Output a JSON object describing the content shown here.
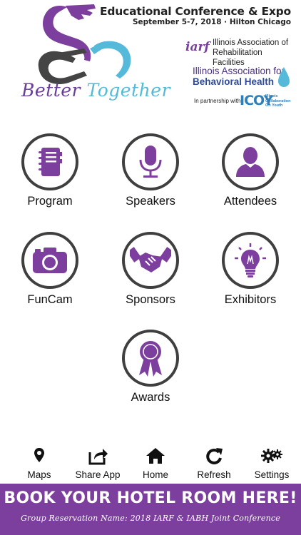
{
  "header": {
    "tagline_word1": "Better",
    "tagline_word2": "Together",
    "conference_title": "Educational Conference & Expo",
    "conference_date": "September 5-7, 2018 · Hilton Chicago",
    "iarf": {
      "mark": "iarf",
      "line1": "Illinois Association of",
      "line2": "Rehabilitation Facilities"
    },
    "iabh": {
      "line1": "Illinois Association for",
      "line2": "Behavioral Health"
    },
    "partner": {
      "prefix": "In partnership with",
      "mark": "ICOY",
      "line1": "Illinois",
      "line2": "Collaboration",
      "line3": "On Youth"
    },
    "colors": {
      "purple": "#7d3f9e",
      "blue": "#55b9d9",
      "dark": "#3f3f3f"
    }
  },
  "tiles": [
    {
      "label": "Program",
      "icon": "notebook-icon"
    },
    {
      "label": "Speakers",
      "icon": "microphone-icon"
    },
    {
      "label": "Attendees",
      "icon": "person-icon"
    },
    {
      "label": "FunCam",
      "icon": "camera-icon"
    },
    {
      "label": "Sponsors",
      "icon": "handshake-icon"
    },
    {
      "label": "Exhibitors",
      "icon": "lightbulb-icon"
    },
    {
      "label": "Awards",
      "icon": "award-ribbon-icon"
    }
  ],
  "toolbar": [
    {
      "label": "Maps",
      "icon": "map-pin-icon"
    },
    {
      "label": "Share App",
      "icon": "share-icon"
    },
    {
      "label": "Home",
      "icon": "home-icon"
    },
    {
      "label": "Refresh",
      "icon": "refresh-icon"
    },
    {
      "label": "Settings",
      "icon": "gear-icon"
    }
  ],
  "hotel_banner": {
    "headline": "BOOK YOUR HOTEL ROOM HERE!",
    "subline": "Group Reservation Name: 2018 IARF & IABH Joint Conference"
  }
}
